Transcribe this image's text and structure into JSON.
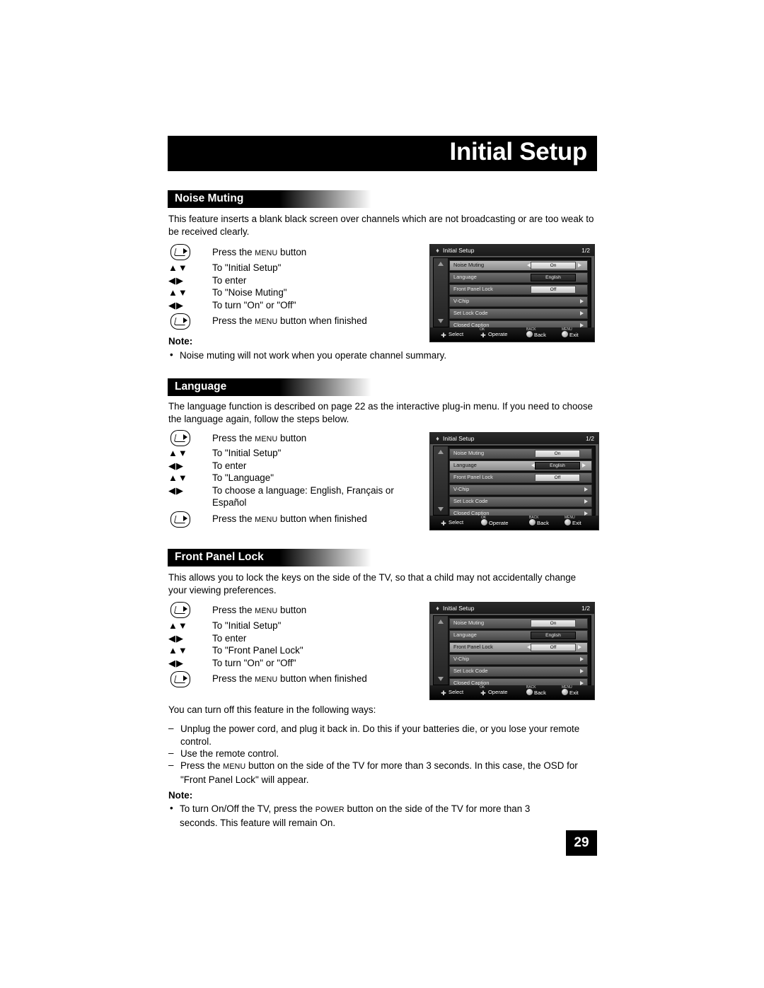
{
  "header": {
    "title": "Initial Setup"
  },
  "page_number": "29",
  "sections": [
    {
      "heading": "Noise Muting",
      "intro": "This feature inserts a blank black screen over channels which are not broadcasting or are too weak to be received clearly.",
      "steps": [
        {
          "cue": "remote",
          "text_before": "Press the ",
          "smallcaps": "MENU",
          "text_after": " button"
        },
        {
          "cue": "▲▼",
          "text": "To \"Initial Setup\""
        },
        {
          "cue": "◀▶",
          "text": "To enter"
        },
        {
          "cue": "▲▼",
          "text": "To \"Noise Muting\""
        },
        {
          "cue": "◀▶",
          "text": "To turn \"On\" or \"Off\""
        },
        {
          "cue": "remote",
          "text_before": "Press the ",
          "smallcaps": "MENU",
          "text_after": " button when finished"
        }
      ],
      "note_title": "Note:",
      "notes": [
        "Noise muting will not work when you operate channel summary."
      ]
    },
    {
      "heading": "Language",
      "intro": "The language function is described on page 22 as the interactive plug-in menu.  If you need to choose the language again, follow the steps below.",
      "steps": [
        {
          "cue": "remote",
          "text_before": "Press the ",
          "smallcaps": "MENU",
          "text_after": " button"
        },
        {
          "cue": "▲▼",
          "text": "To \"Initial Setup\""
        },
        {
          "cue": "◀▶",
          "text": "To enter"
        },
        {
          "cue": "▲▼",
          "text": "To \"Language\""
        },
        {
          "cue": "◀▶",
          "text": "To choose a language: English, Français or"
        },
        {
          "cue": "",
          "text": "Español"
        },
        {
          "cue": "remote",
          "text_before": "Press the ",
          "smallcaps": "MENU",
          "text_after": " button when finished"
        }
      ]
    },
    {
      "heading": "Front Panel Lock",
      "intro": "This allows you to lock the keys on the side of the TV, so that a child may not accidentally change your viewing preferences.",
      "steps": [
        {
          "cue": "remote",
          "text_before": "Press the ",
          "smallcaps": "MENU",
          "text_after": " button"
        },
        {
          "cue": "▲▼",
          "text": "To \"Initial Setup\""
        },
        {
          "cue": "◀▶",
          "text": "To enter"
        },
        {
          "cue": "▲▼",
          "text": "To \"Front Panel Lock\""
        },
        {
          "cue": "◀▶",
          "text": "To turn \"On\" or \"Off\""
        },
        {
          "cue": "remote",
          "text_before": "Press the ",
          "smallcaps": "MENU",
          "text_after": " button when finished"
        }
      ]
    }
  ],
  "closing": {
    "lead": "You can turn off this feature in the following ways:",
    "items": [
      {
        "text": "Unplug the power cord, and plug it back in. Do this if your batteries die, or you lose your remote control."
      },
      {
        "text": "Use the remote control."
      },
      {
        "text_before": "Press the ",
        "smallcaps": "MENU",
        "text_after": " button on the side of the TV for more than 3 seconds. In this case, the OSD for \"Front Panel Lock\" will appear."
      }
    ],
    "note_title": "Note:",
    "note_before": "To turn On/Off the TV, press the ",
    "note_smallcaps": "POWER",
    "note_after": " button on the side of the TV for more than 3 seconds. This feature will remain On."
  },
  "osd": {
    "title": "Initial Setup",
    "page_indicator": "1/2",
    "rows": [
      {
        "name": "Noise Muting",
        "value": "On",
        "kind": "value"
      },
      {
        "name": "Language",
        "value": "English",
        "kind": "value-dark"
      },
      {
        "name": "Front Panel Lock",
        "value": "Off",
        "kind": "value"
      },
      {
        "name": "V-Chip",
        "value": "",
        "kind": "chevron"
      },
      {
        "name": "Set Lock Code",
        "value": "",
        "kind": "chevron"
      },
      {
        "name": "Closed Caption",
        "value": "",
        "kind": "chevron"
      }
    ],
    "footer": [
      {
        "cap": "",
        "label": "Select",
        "icon": "dpad-icon"
      },
      {
        "cap": "OK",
        "label": "Operate",
        "icon": "dpad-icon"
      },
      {
        "cap": "BACK",
        "label": "Back",
        "icon": "round-button-icon"
      },
      {
        "cap": "MENU",
        "label": "Exit",
        "icon": "round-button-icon"
      }
    ],
    "selected_index": {
      "noise": 0,
      "language": 1,
      "front": 2
    }
  }
}
